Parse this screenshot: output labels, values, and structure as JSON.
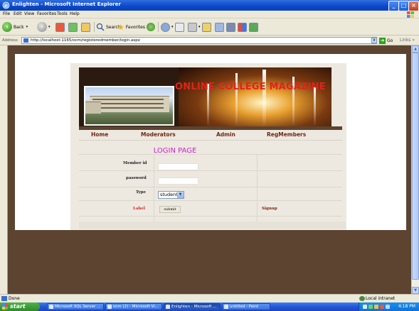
{
  "window": {
    "title": "Enlighten - Microsoft Internet Explorer",
    "minimize": "_",
    "maximize": "□",
    "close": "×"
  },
  "menu": [
    "File",
    "Edit",
    "View",
    "Favorites",
    "Tools",
    "Help"
  ],
  "toolbar": {
    "back": "Back",
    "search": "Search",
    "favorites": "Favorites"
  },
  "address": {
    "label": "Address",
    "url": "http://localhost:1165/ocm/registeredmember/login.aspx",
    "go": "Go",
    "links": "Links",
    "more": "»"
  },
  "site": {
    "title": "ONLINE COLLEGE MAGAZINE",
    "nav": [
      "Home",
      "Moderators",
      "Admin",
      "RegMembers"
    ]
  },
  "login": {
    "heading": "LOGIN PAGE",
    "member_id_label": "Member id",
    "password_label": "password",
    "type_label": "Type",
    "type_value": "student",
    "status_label": "Label",
    "submit": "submit",
    "signup": "Signup"
  },
  "status": {
    "text": "Done",
    "zone": "Local intranet"
  },
  "taskbar": {
    "start": "start",
    "tasks": [
      "Microsoft SQL Server ...",
      "ocm (2) - Microsoft Vi...",
      "Enlighten - Microsoft ...",
      "untitled - Paint"
    ],
    "clock": "4:18 PM"
  },
  "colors": {
    "accent_title": "#e4221a",
    "login_heading": "#cc22cc",
    "nav_text": "#6b2814",
    "page_bg": "#5c4430"
  }
}
